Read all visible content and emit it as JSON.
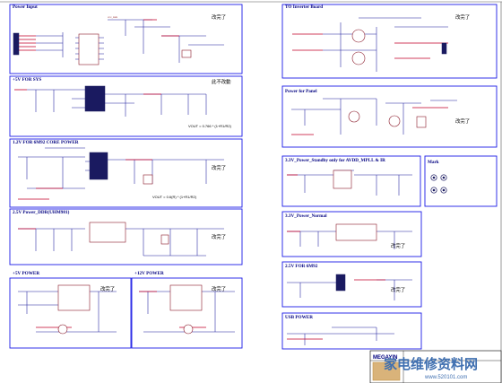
{
  "blocks": [
    {
      "id": "power_input",
      "title": "Power Input",
      "note": "改完了"
    },
    {
      "id": "plus5v_sys",
      "title": "+5V FOR SYS",
      "note": "此不改動",
      "vout": "VOUT = 0.766 * (1+R1/R2)"
    },
    {
      "id": "v12_core",
      "title": "1.2V FOR 6M92 CORE POWER",
      "note": "改完了",
      "vout": "VOUT = 0.6(R) * (1+R1/R2)"
    },
    {
      "id": "v25_ddr",
      "title": "2.5V Power_DDR(UHM981)",
      "note": "改完了"
    },
    {
      "id": "plus5v_power",
      "title": "+5V POWER",
      "note": "改完了"
    },
    {
      "id": "plus12v_power",
      "title": "+12V POWER",
      "note": "改完了"
    },
    {
      "id": "to_inverter",
      "title": "TO Inverter Board",
      "note": "改完了"
    },
    {
      "id": "power_panel",
      "title": "Power for Panel",
      "note": "改完了"
    },
    {
      "id": "v33_standby",
      "title": "3.3V_Power_Standby only for AVDD_MPLL & IR"
    },
    {
      "id": "mark",
      "title": "Mark"
    },
    {
      "id": "v33_normal",
      "title": "3.3V_Power_Normal",
      "note": "改完了"
    },
    {
      "id": "v25_6m92",
      "title": "2.5V FOR 6M92",
      "note": "改完了"
    },
    {
      "id": "usb_power",
      "title": "USB POWER"
    }
  ],
  "title_block": {
    "label": "MEGAYIN"
  },
  "watermark": {
    "main": "家电维修资料网",
    "url": "www.520101.com"
  },
  "colors": {
    "border": "#1a1ae6",
    "title": "#000080",
    "wire": "#1d1d9e",
    "highlight": "#c2002a"
  }
}
